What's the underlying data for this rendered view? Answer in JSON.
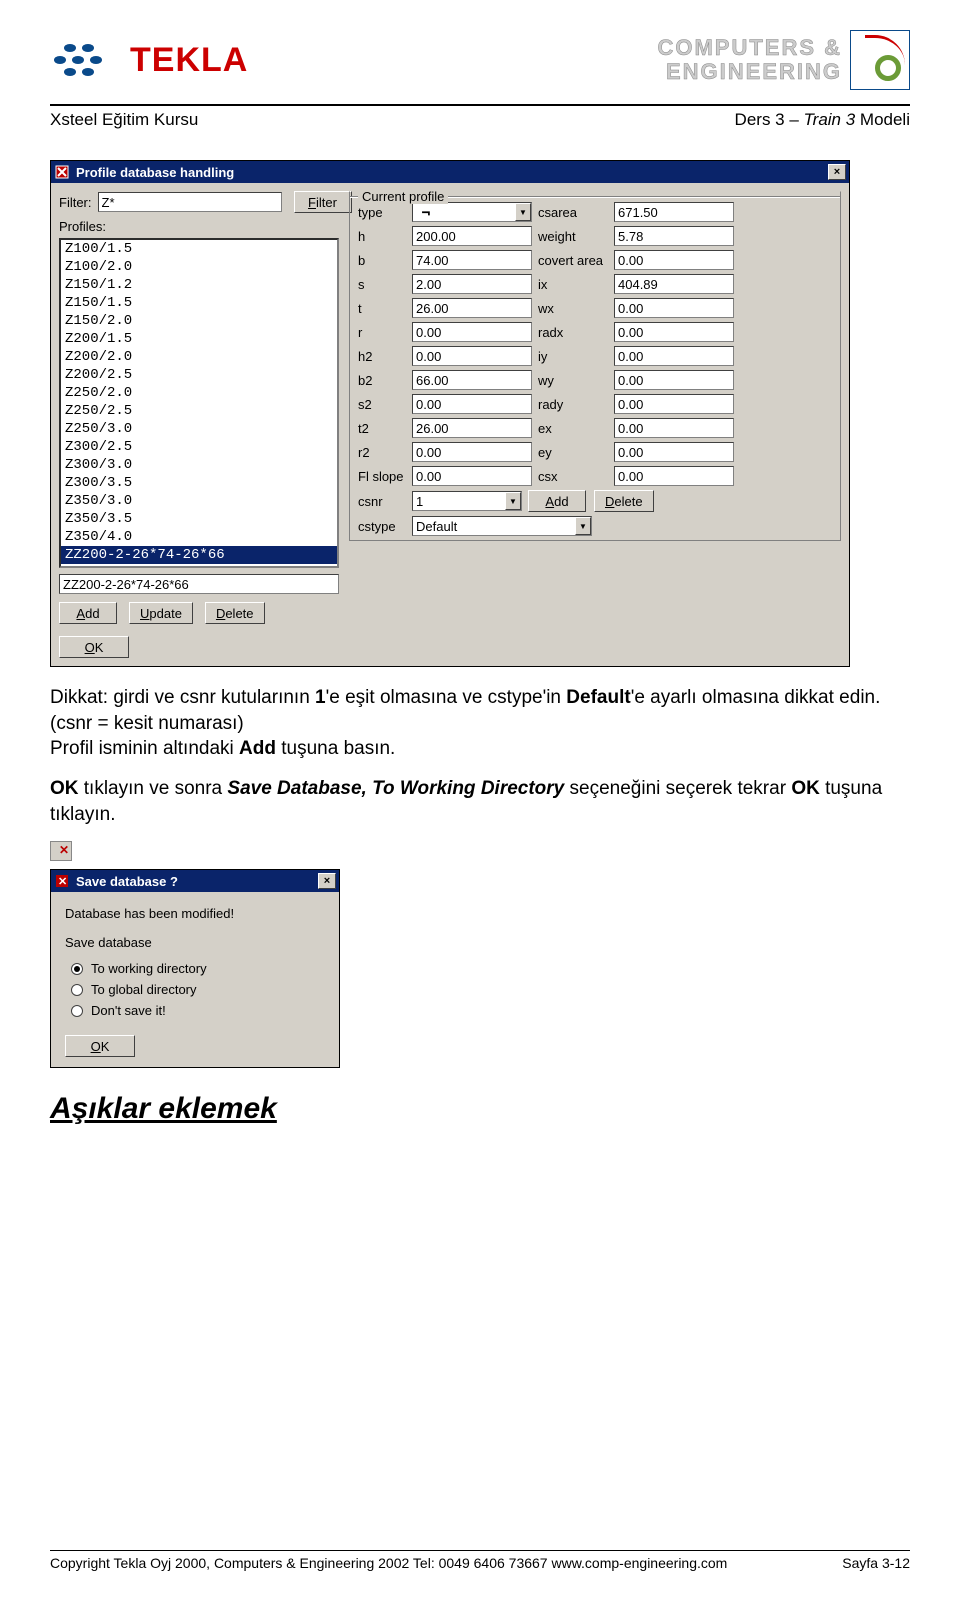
{
  "header": {
    "tekla_brand": "TEKLA",
    "ce_line1": "COMPUTERS &",
    "ce_line2": "ENGINEERING",
    "course_left": "Xsteel Eğitim Kursu",
    "course_right_prefix": "Ders 3 – ",
    "course_right_italic": "Train 3",
    "course_right_suffix": "  Modeli"
  },
  "dialog1": {
    "title": "Profile database handling",
    "close_x": "×",
    "filter_label": "Filter:",
    "filter_value": "Z*",
    "filter_button": "Filter",
    "filter_button_u": "F",
    "profiles_label": "Profiles:",
    "listbox_items": [
      "Z100/1.5",
      "Z100/2.0",
      "Z150/1.2",
      "Z150/1.5",
      "Z150/2.0",
      "Z200/1.5",
      "Z200/2.0",
      "Z200/2.5",
      "Z250/2.0",
      "Z250/2.5",
      "Z250/3.0",
      "Z300/2.5",
      "Z300/3.0",
      "Z300/3.5",
      "Z350/3.0",
      "Z350/3.5",
      "Z350/4.0",
      "ZZ200-2-26*74-26*66"
    ],
    "selected_index": 17,
    "name_field": "ZZ200-2-26*74-26*66",
    "add_btn": "Add",
    "add_u": "A",
    "update_btn": "Update",
    "update_u": "U",
    "delete_btn": "Delete",
    "delete_u": "D",
    "ok_btn": "OK",
    "ok_u": "O",
    "group_title": "Current profile",
    "left_labels": [
      "type",
      "h",
      "b",
      "s",
      "t",
      "r",
      "h2",
      "b2",
      "s2",
      "t2",
      "r2",
      "Fl slope"
    ],
    "left_values": [
      "",
      "200.00",
      "74.00",
      "2.00",
      "26.00",
      "0.00",
      "0.00",
      "66.00",
      "0.00",
      "26.00",
      "0.00",
      "0.00"
    ],
    "type_symbol": "╗",
    "right_labels": [
      "csarea",
      "weight",
      "covert area",
      "ix",
      "wx",
      "radx",
      "iy",
      "wy",
      "rady",
      "ex",
      "ey",
      "csx"
    ],
    "right_values": [
      "671.50",
      "5.78",
      "0.00",
      "404.89",
      "0.00",
      "0.00",
      "0.00",
      "0.00",
      "0.00",
      "0.00",
      "0.00",
      "0.00"
    ],
    "csnr_label": "csnr",
    "csnr_value": "1",
    "csnr_add": "Add",
    "csnr_add_u": "A",
    "csnr_delete": "Delete",
    "csnr_delete_u": "D",
    "cstype_label": "cstype",
    "cstype_value": "Default"
  },
  "para1_a": "Dikkat: girdi ve csnr kutularının ",
  "para1_b": "1",
  "para1_c": "'e eşit olmasına ve cstype'in ",
  "para1_d": "Default",
  "para1_e": "'e ayarlı olmasına dikkat edin. (csnr = kesit numarası)",
  "para1_f": "Profil isminin altındaki ",
  "para1_g": "Add",
  "para1_h": " tuşuna basın.",
  "para2_a": "OK",
  "para2_b": " tıklayın ve sonra ",
  "para2_c": "Save Database, To Working Directory",
  "para2_d": " seçeneğini seçerek tekrar ",
  "para2_e": "OK",
  "para2_f": " tuşuna tıklayın.",
  "dialog2": {
    "title": "Save database ?",
    "close_x": "×",
    "msg": "Database has been modified!",
    "msg2": "Save database",
    "opt1": "To working directory",
    "opt2": "To global directory",
    "opt3": "Don't save it!",
    "ok_btn": "OK",
    "ok_u": "O"
  },
  "heading": "Aşıklar eklemek",
  "footer": {
    "left": "Copyright Tekla Oyj 2000, Computers & Engineering 2002 Tel: 0049 6406 73667 www.comp-engineering.com",
    "right": "Sayfa 3-12"
  }
}
